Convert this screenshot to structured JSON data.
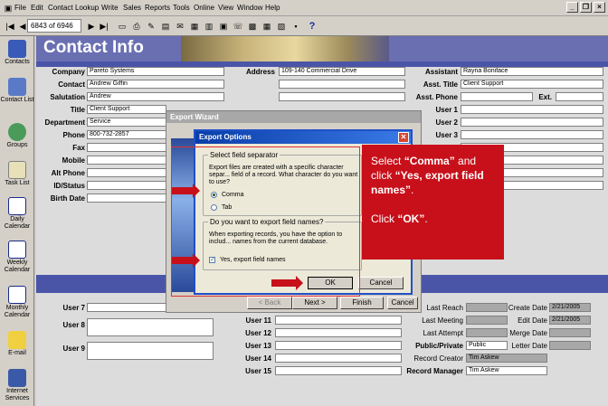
{
  "menu": {
    "items": [
      "File",
      "Edit",
      "Contact",
      "Lookup",
      "Write",
      "Sales",
      "Reports",
      "Tools",
      "Online",
      "View",
      "Window",
      "Help"
    ]
  },
  "toolbar": {
    "record_counter": "6843 of 6946"
  },
  "sidebar": {
    "items": [
      {
        "label": "Contacts",
        "icon": "contacts-icon"
      },
      {
        "label": "Contact List",
        "icon": "contact-list-icon"
      },
      {
        "label": "Groups",
        "icon": "groups-icon"
      },
      {
        "label": "Task List",
        "icon": "task-list-icon"
      },
      {
        "label": "Daily Calendar",
        "icon": "daily-calendar-icon"
      },
      {
        "label": "Weekly Calendar",
        "icon": "weekly-calendar-icon"
      },
      {
        "label": "Monthly Calendar",
        "icon": "monthly-calendar-icon"
      },
      {
        "label": "E-mail",
        "icon": "email-icon"
      },
      {
        "label": "Internet Services",
        "icon": "internet-services-icon"
      }
    ]
  },
  "header": {
    "title": "Contact Info"
  },
  "contact": {
    "company_label": "Company",
    "company": "Pareto Systems",
    "contact_label": "Contact",
    "contact": "Andrew Giffin",
    "salutation_label": "Salutation",
    "salutation": "Andrew",
    "title_label": "Title",
    "title": "Client Support",
    "department_label": "Department",
    "department": "Service",
    "phone_label": "Phone",
    "phone": "800-732-2857",
    "fax_label": "Fax",
    "mobile_label": "Mobile",
    "alt_phone_label": "Alt Phone",
    "id_status_label": "ID/Status",
    "birth_date_label": "Birth Date",
    "address_label": "Address",
    "address": "109-140 Commercial Drive",
    "assistant_label": "Assistant",
    "assistant": "Rayna Boniface",
    "asst_title_label": "Asst. Title",
    "asst_title": "Client Support",
    "asst_phone_label": "Asst. Phone",
    "ext_label": "Ext.",
    "user1_label": "User 1",
    "user2_label": "User 2",
    "user3_label": "User 3"
  },
  "lower": {
    "user7": "User 7",
    "user8": "User 8",
    "user9": "User 9",
    "user11": "User 11",
    "user12": "User 12",
    "user13": "User 13",
    "user14": "User 14",
    "user15": "User 15",
    "last_reach_label": "Last Reach",
    "last_meeting_label": "Last Meeting",
    "last_attempt_label": "Last Attempt",
    "public_private_label": "Public/Private",
    "public_private": "Public",
    "record_creator_label": "Record Creator",
    "record_creator": "Tim Askew",
    "record_manager_label": "Record Manager",
    "record_manager": "Tim Askew",
    "create_date_label": "Create Date",
    "create_date": "2/21/2005",
    "edit_date_label": "Edit Date",
    "edit_date": "2/21/2005",
    "merge_date_label": "Merge Date",
    "letter_date_label": "Letter Date"
  },
  "wizard": {
    "title": "Export Wizard",
    "next": "Next >",
    "finish": "Finish",
    "cancel": "Cancel",
    "back": "< Back"
  },
  "dialog": {
    "title": "Export Options",
    "sep_group": "Select field separator",
    "sep_text": "Export files are created with a specific character separ... field of a record. What character do you want to use?",
    "comma": "Comma",
    "tab": "Tab",
    "names_group": "Do you want to export field names?",
    "names_text": "When exporting records, you have the option to includ... names from the current database.",
    "yes_names": "Yes, export field names",
    "ok": "OK",
    "cancel": "Cancel"
  },
  "callout": {
    "line1a": "Select ",
    "line1b": "“Comma”",
    "line1c": " and click ",
    "line1d": "“Yes, export field names”",
    "line1e": ".",
    "line2a": "Click ",
    "line2b": "“OK”",
    "line2c": "."
  },
  "colors": {
    "accent": "#c8101a",
    "banner": "#6a6fb2",
    "band": "#4a55a8"
  }
}
